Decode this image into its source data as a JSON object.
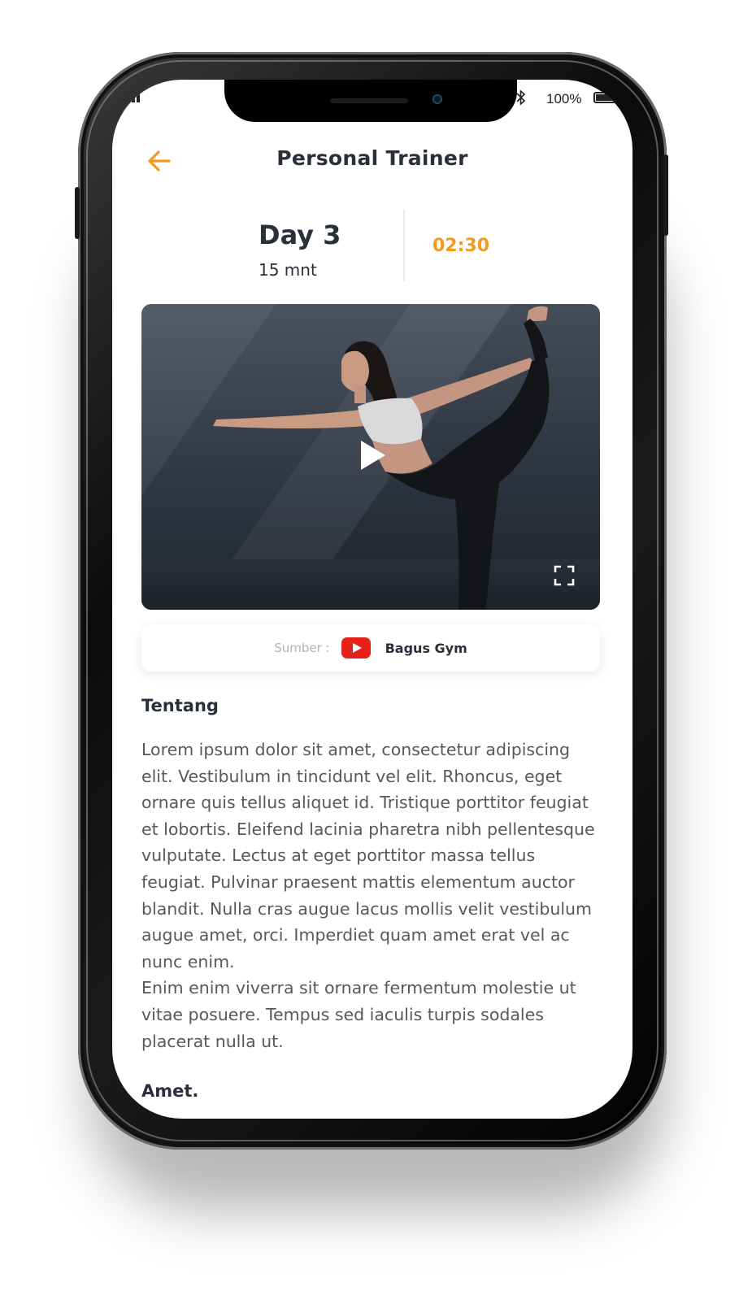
{
  "status_bar": {
    "battery_percent": "100%",
    "bluetooth_icon": "bluetooth-icon",
    "battery_icon": "battery-icon"
  },
  "header": {
    "title": "Personal Trainer",
    "back_icon": "arrow-left-icon"
  },
  "session": {
    "day": "Day 3",
    "duration": "15 mnt",
    "timer": "02:30"
  },
  "video": {
    "play_icon": "play-icon",
    "fullscreen_icon": "fullscreen-icon"
  },
  "source": {
    "label": "Sumber :",
    "icon": "youtube-icon",
    "name": "Bagus Gym"
  },
  "about": {
    "title": "Tentang",
    "paragraphs": [
      "Lorem ipsum dolor sit amet, consectetur adipiscing elit. Vestibulum in tincidunt vel elit. Rhoncus, eget ornare quis tellus aliquet id. Tristique porttitor feugiat et lobortis. Eleifend lacinia pharetra nibh pellentesque vulputate. Lectus at eget porttitor massa tellus feugiat. Pulvinar praesent mattis elementum auctor blandit. Nulla cras augue lacus mollis velit vestibulum augue amet, orci. Imperdiet quam amet erat vel ac nunc enim.",
      "Enim enim viverra sit ornare fermentum molestie ut vitae posuere. Tempus sed iaculis turpis sodales placerat nulla ut."
    ]
  },
  "next_section": {
    "title": "Amet."
  },
  "colors": {
    "accent": "#f39a1e",
    "text_dark": "#2a2f3c",
    "text_body": "#55585f",
    "youtube_red": "#e62117"
  }
}
